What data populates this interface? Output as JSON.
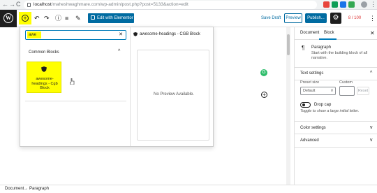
{
  "browser": {
    "back": "←",
    "forward": "→",
    "reload": "C",
    "url_host": "localhost",
    "url_path": "/maheshwaghmare.com/wp-admin/post.php?post=5133&action=edit",
    "ext_colors": [
      "#e8453c",
      "#0f9d58",
      "#1a73e8",
      "#34a853",
      "#9aa0a6"
    ]
  },
  "header": {
    "wp_logo": "W",
    "inserter_symbol": "+",
    "undo": "↶",
    "redo": "↷",
    "info": "ⓘ",
    "outline": "≡",
    "tools": "✎",
    "elementor_label": "Edit with Elementor",
    "save_draft": "Save Draft",
    "preview": "Preview",
    "publish": "Publish...",
    "settings_symbol": "⚙",
    "seo_score": "8 / 100",
    "more": "⋮"
  },
  "inserter": {
    "search_value": "awe",
    "clear_symbol": "✕",
    "category_title": "Common Blocks",
    "category_chevron": "^",
    "block_label": "awesome-headings - Cgb Block",
    "preview_title": "awesome-headings - CGB Block",
    "preview_message": "No Preview Available."
  },
  "canvas": {
    "badge": "G",
    "add_block": "+"
  },
  "sidebar": {
    "tab_document": "Document",
    "tab_block": "Block",
    "close": "✕",
    "block_name": "Paragraph",
    "block_desc": "Start with the building block of all narrative.",
    "text_settings": "Text settings",
    "preset_label": "Preset size",
    "preset_value": "Default",
    "custom_label": "Custom",
    "reset": "Reset",
    "drop_cap": "Drop cap",
    "drop_cap_help": "Toggle to show a large initial letter.",
    "color_settings": "Color settings",
    "advanced": "Advanced",
    "chev_up": "^",
    "chev_down": "v"
  },
  "footer": {
    "crumb1": "Document",
    "sep": "→",
    "crumb2": "Paragraph"
  }
}
